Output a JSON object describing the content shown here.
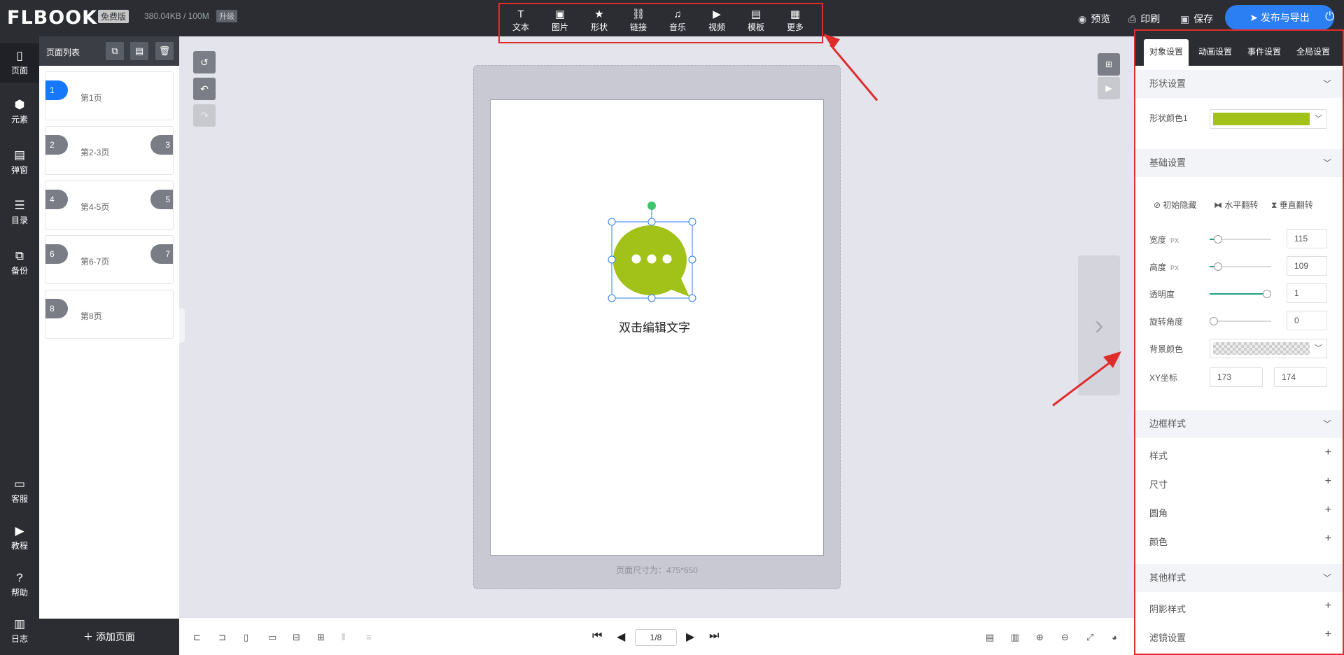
{
  "app": {
    "logo": "FLBOOK",
    "logo_mark": "®",
    "plan_badge": "免费版",
    "storage": "380.04KB / 100M",
    "upgrade_label": "升级"
  },
  "toolbar": {
    "tools": [
      {
        "label": "文本",
        "icon": "text-icon",
        "glyph": "T"
      },
      {
        "label": "图片",
        "icon": "image-icon",
        "glyph": "▣"
      },
      {
        "label": "形状",
        "icon": "star-icon",
        "glyph": "★"
      },
      {
        "label": "链接",
        "icon": "link-icon",
        "glyph": "⛓"
      },
      {
        "label": "音乐",
        "icon": "music-icon",
        "glyph": "♫"
      },
      {
        "label": "视频",
        "icon": "video-icon",
        "glyph": "▶"
      },
      {
        "label": "模板",
        "icon": "template-icon",
        "glyph": "▤"
      },
      {
        "label": "更多",
        "icon": "more-icon",
        "glyph": "▦"
      }
    ]
  },
  "header_actions": {
    "preview": "预览",
    "print": "印刷",
    "save": "保存",
    "publish": "发布与导出"
  },
  "left_nav": {
    "top": [
      {
        "label": "页面",
        "icon": "page-icon",
        "glyph": "▯"
      },
      {
        "label": "元素",
        "icon": "elements-icon",
        "glyph": "⬢"
      },
      {
        "label": "弹窗",
        "icon": "popup-icon",
        "glyph": "▤"
      },
      {
        "label": "目录",
        "icon": "catalog-icon",
        "glyph": "☰"
      },
      {
        "label": "备份",
        "icon": "backup-icon",
        "glyph": "⧉"
      }
    ],
    "bottom": [
      {
        "label": "客服",
        "icon": "service-icon",
        "glyph": "▭"
      },
      {
        "label": "教程",
        "icon": "tutorial-icon",
        "glyph": "▶"
      },
      {
        "label": "帮助",
        "icon": "help-icon",
        "glyph": "?"
      },
      {
        "label": "日志",
        "icon": "log-icon",
        "glyph": "▥"
      }
    ]
  },
  "page_panel": {
    "title": "页面列表",
    "pages": [
      {
        "left": "1",
        "right": "",
        "label": "第1页"
      },
      {
        "left": "2",
        "right": "3",
        "label": "第2-3页"
      },
      {
        "left": "4",
        "right": "5",
        "label": "第4-5页"
      },
      {
        "left": "6",
        "right": "7",
        "label": "第6-7页"
      },
      {
        "left": "8",
        "right": "",
        "label": "第8页"
      }
    ],
    "add_label": "添加页面"
  },
  "canvas": {
    "text_element": "双击编辑文字",
    "page_size": "页面尺寸为：475*650",
    "shape_color": "#a2c21a"
  },
  "pager": {
    "current": "1/8"
  },
  "right_panel": {
    "tabs": [
      "对象设置",
      "动画设置",
      "事件设置",
      "全局设置"
    ],
    "shape_section": {
      "title": "形状设置",
      "color_label": "形状颜色1",
      "color": "#a2c21a"
    },
    "basic_section": {
      "title": "基础设置",
      "toggles": [
        "初始隐藏",
        "水平翻转",
        "垂直翻转"
      ],
      "width_label": "宽度",
      "width_unit": "PX",
      "width": "115",
      "height_label": "高度",
      "height_unit": "PX",
      "height": "109",
      "opacity_label": "透明度",
      "opacity": "1",
      "rotation_label": "旋转角度",
      "rotation": "0",
      "bg_label": "背景颜色",
      "xy_label": "XY坐标",
      "x": "173",
      "y": "174"
    },
    "border_section": {
      "title": "边框样式",
      "rows": [
        "样式",
        "尺寸",
        "圆角",
        "颜色"
      ]
    },
    "other_section": {
      "title": "其他样式",
      "rows": [
        "阴影样式",
        "滤镜设置"
      ]
    }
  }
}
